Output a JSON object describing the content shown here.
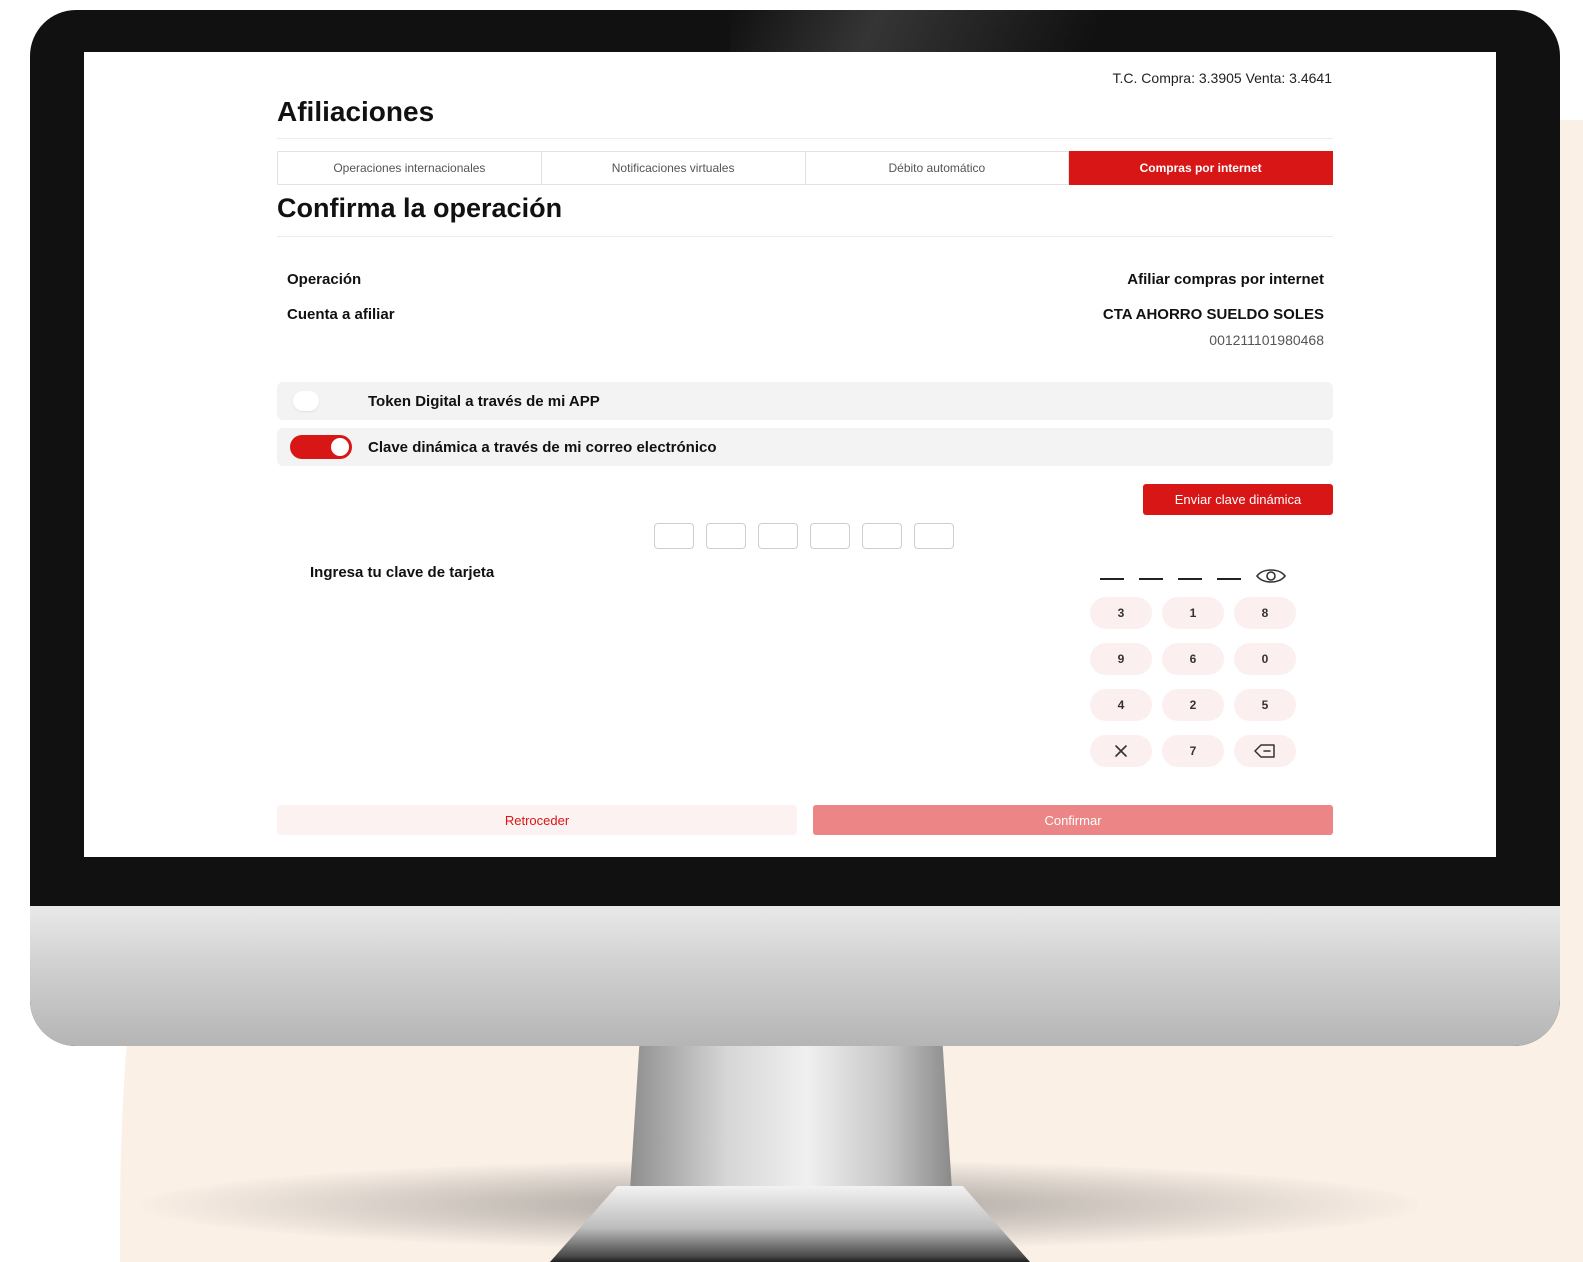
{
  "header": {
    "exchange_rate": "T.C. Compra: 3.3905 Venta: 3.4641",
    "title": "Afiliaciones"
  },
  "tabs": [
    {
      "label": "Operaciones internacionales",
      "active": false
    },
    {
      "label": "Notificaciones virtuales",
      "active": false
    },
    {
      "label": "Débito automático",
      "active": false
    },
    {
      "label": "Compras por internet",
      "active": true
    }
  ],
  "section": {
    "title": "Confirma la operación"
  },
  "details": {
    "operation_label": "Operación",
    "operation_value": "Afiliar compras por internet",
    "account_label": "Cuenta a afiliar",
    "account_value": "CTA AHORRO SUELDO SOLES",
    "account_number": "001211101980468"
  },
  "options": {
    "token_label": "Token Digital a través de mi APP",
    "token_enabled": false,
    "dynamic_key_label": "Clave dinámica a través de mi correo electrónico",
    "dynamic_key_enabled": true
  },
  "send_button_label": "Enviar clave dinámica",
  "otp_box_count": 6,
  "pin": {
    "label": "Ingresa tu clave de tarjeta",
    "keys": [
      "3",
      "1",
      "8",
      "9",
      "6",
      "0",
      "4",
      "2",
      "5",
      "clear-icon",
      "7",
      "backspace-icon"
    ]
  },
  "actions": {
    "back_label": "Retroceder",
    "confirm_label": "Confirmar"
  },
  "colors": {
    "accent": "#d91616",
    "confirm_disabled": "#ec8585",
    "back_bg": "#fdf2f2",
    "key_bg": "#fbeff0"
  }
}
